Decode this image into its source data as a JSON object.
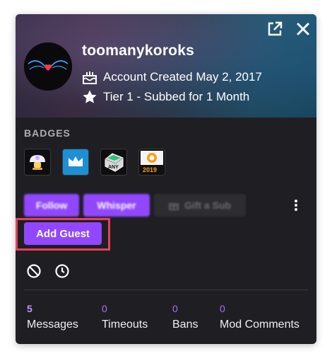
{
  "user": {
    "username": "toomanykoroks",
    "account_created": "Account Created May 2, 2017",
    "subscription": "Tier 1 - Subbed for 1 Month"
  },
  "badges": {
    "title": "BADGES",
    "items": [
      "mushroom-badge-icon",
      "crown-badge-icon",
      "any-key-badge-icon",
      "overwatch-2019-badge-icon"
    ],
    "year_label": "2019",
    "any_label": "ANY"
  },
  "actions": {
    "follow": "Follow",
    "whisper": "Whisper",
    "gift_sub": "Gift a Sub",
    "add_guest": "Add Guest"
  },
  "stats": [
    {
      "value": "5",
      "label": "Messages"
    },
    {
      "value": "0",
      "label": "Timeouts"
    },
    {
      "value": "0",
      "label": "Bans"
    },
    {
      "value": "0",
      "label": "Mod Comments"
    }
  ],
  "colors": {
    "accent": "#9147ff",
    "highlight": "#e5405a",
    "card_bg": "#1f1f23"
  }
}
